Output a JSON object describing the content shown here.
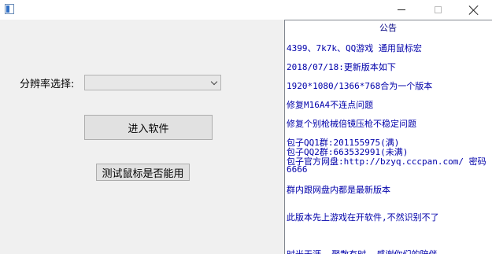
{
  "titlebar": {
    "app_icon": "app-window-icon",
    "minimize_icon": "minimize-icon",
    "maximize_icon": "maximize-icon",
    "close_icon": "close-icon"
  },
  "form": {
    "resolution_label": "分辨率选择:",
    "resolution_value": "",
    "enter_button": "进入软件",
    "test_button": "测试鼠标是否能用"
  },
  "notice": {
    "title": "公告",
    "lines": [
      "4399、7k7k、QQ游戏 通用鼠标宏",
      "2018/07/18:更新版本如下",
      "1920*1080/1366*768合为一个版本",
      "修复M16A4不连点问题",
      "修复个别枪械倍镜压枪不稳定问题",
      "包子QQ1群:201155975(满)",
      "包子QQ2群:663532991(未满)",
      "包子官方网盘:http://bzyq.cccpan.com/  密码",
      "6666",
      "群内跟网盘内都是最新版本",
      "此版本先上游戏在开软件,不然识别不了",
      "时光无涯, 聚散有时, 感谢你们的陪伴~"
    ]
  }
}
